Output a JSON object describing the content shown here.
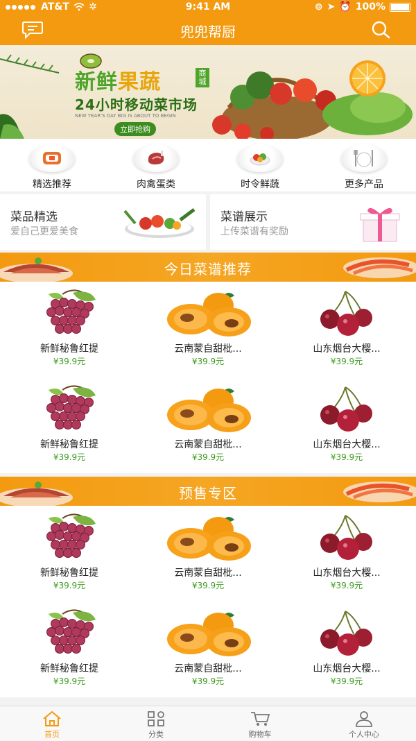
{
  "status_bar": {
    "carrier": "AT&T",
    "time": "9:41 AM",
    "battery": "100%"
  },
  "header": {
    "title": "兜兜帮厨",
    "left_icon": "message-icon",
    "right_icon": "search-icon"
  },
  "banner": {
    "title_green": "新鲜",
    "title_yellow": "果蔬",
    "tag": "商城",
    "subtitle": "24小时移动菜市场",
    "english": "NEW YEAR'S DAY BIG IS ABOUT TO BEGIN",
    "cta": "立即抢购"
  },
  "categories": [
    {
      "label": "精选推荐",
      "icon": "sushi-icon"
    },
    {
      "label": "肉禽蛋类",
      "icon": "ham-icon"
    },
    {
      "label": "时令鲜蔬",
      "icon": "salad-icon"
    },
    {
      "label": "更多产品",
      "icon": "cutlery-icon"
    }
  ],
  "promos": [
    {
      "title": "菜品精选",
      "subtitle": "爱自己更爱美食",
      "icon": "vegetables-icon"
    },
    {
      "title": "菜谱展示",
      "subtitle": "上传菜谱有奖励",
      "icon": "gift-box-icon"
    }
  ],
  "sections": [
    {
      "title": "今日菜谱推荐",
      "products": [
        {
          "name": "新鲜秘鲁红提",
          "price": "¥39.9元",
          "icon": "grape-icon"
        },
        {
          "name": "云南蒙自甜枇...",
          "price": "¥39.9元",
          "icon": "apricot-icon"
        },
        {
          "name": "山东烟台大樱...",
          "price": "¥39.9元",
          "icon": "cherry-icon"
        },
        {
          "name": "新鲜秘鲁红提",
          "price": "¥39.9元",
          "icon": "grape-icon"
        },
        {
          "name": "云南蒙自甜枇...",
          "price": "¥39.9元",
          "icon": "apricot-icon"
        },
        {
          "name": "山东烟台大樱...",
          "price": "¥39.9元",
          "icon": "cherry-icon"
        }
      ]
    },
    {
      "title": "预售专区",
      "products": [
        {
          "name": "新鲜秘鲁红提",
          "price": "¥39.9元",
          "icon": "grape-icon"
        },
        {
          "name": "云南蒙自甜枇...",
          "price": "¥39.9元",
          "icon": "apricot-icon"
        },
        {
          "name": "山东烟台大樱...",
          "price": "¥39.9元",
          "icon": "cherry-icon"
        },
        {
          "name": "新鲜秘鲁红提",
          "price": "¥39.9元",
          "icon": "grape-icon"
        },
        {
          "name": "云南蒙自甜枇...",
          "price": "¥39.9元",
          "icon": "apricot-icon"
        },
        {
          "name": "山东烟台大樱...",
          "price": "¥39.9元",
          "icon": "cherry-icon"
        }
      ]
    }
  ],
  "tabbar": [
    {
      "label": "首页",
      "icon": "home-icon",
      "active": true
    },
    {
      "label": "分类",
      "icon": "grid-icon",
      "active": false
    },
    {
      "label": "购物车",
      "icon": "cart-icon",
      "active": false
    },
    {
      "label": "个人中心",
      "icon": "user-icon",
      "active": false
    }
  ],
  "colors": {
    "brand": "#f39a10",
    "price": "#3c9a1e",
    "tab_active": "#f39a10"
  }
}
